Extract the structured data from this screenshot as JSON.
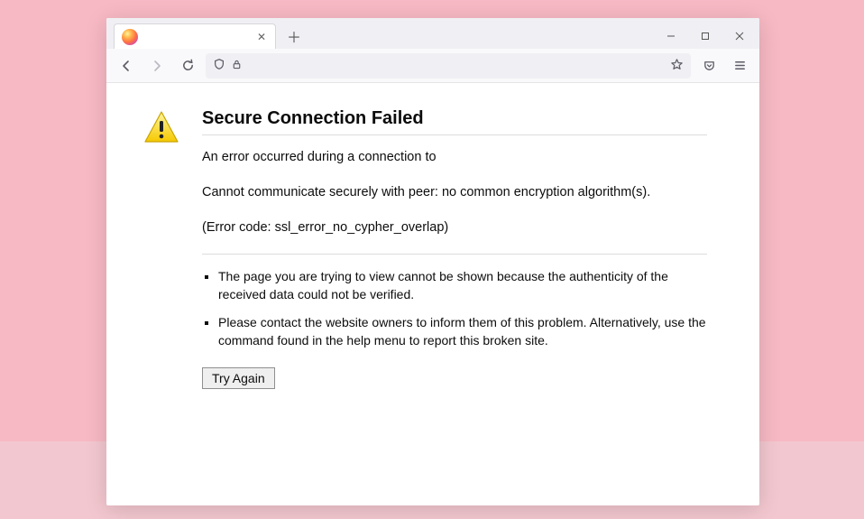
{
  "window_controls": {
    "minimize": "–",
    "maximize": "☐",
    "close": "✕"
  },
  "tabs": {
    "close_glyph": "✕",
    "newtab_glyph": "＋"
  },
  "error": {
    "title": "Secure Connection Failed",
    "line1": "An error occurred during a connection to",
    "line2": "Cannot communicate securely with peer: no common encryption algorithm(s).",
    "code": "(Error code: ssl_error_no_cypher_overlap)",
    "bullets": [
      "The page you are trying to view cannot be shown because the authenticity of the received data could not be verified.",
      "Please contact the website owners to inform them of this problem. Alternatively, use the command found in the help menu to report this broken site."
    ],
    "try_again": "Try Again"
  }
}
